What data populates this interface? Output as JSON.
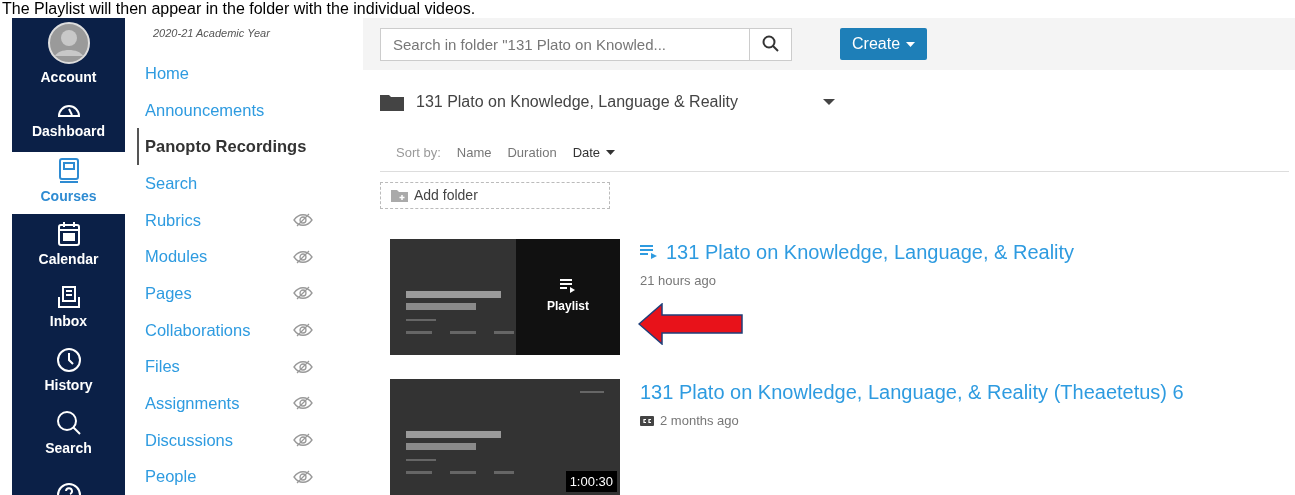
{
  "caption": "The Playlist will then appear in the folder with the individual videos.",
  "global_nav": [
    {
      "label": "Account",
      "kind": "avatar",
      "selected": false
    },
    {
      "label": "Dashboard",
      "kind": "gauge",
      "selected": false
    },
    {
      "label": "Courses",
      "kind": "book",
      "selected": true
    },
    {
      "label": "Calendar",
      "kind": "calendar",
      "selected": false
    },
    {
      "label": "Inbox",
      "kind": "inbox",
      "selected": false
    },
    {
      "label": "History",
      "kind": "clock",
      "selected": false
    },
    {
      "label": "Search",
      "kind": "search",
      "selected": false
    },
    {
      "kind": "help",
      "selected": false
    }
  ],
  "course_nav": {
    "term": "2020-21 Academic Year",
    "items": [
      {
        "label": "Home",
        "selected": false,
        "hidden": false
      },
      {
        "label": "Announcements",
        "selected": false,
        "hidden": false
      },
      {
        "label": "Panopto Recordings",
        "selected": true,
        "hidden": false
      },
      {
        "label": "Search",
        "selected": false,
        "hidden": false
      },
      {
        "label": "Rubrics",
        "selected": false,
        "hidden": true
      },
      {
        "label": "Modules",
        "selected": false,
        "hidden": true
      },
      {
        "label": "Pages",
        "selected": false,
        "hidden": true
      },
      {
        "label": "Collaborations",
        "selected": false,
        "hidden": true
      },
      {
        "label": "Files",
        "selected": false,
        "hidden": true
      },
      {
        "label": "Assignments",
        "selected": false,
        "hidden": true
      },
      {
        "label": "Discussions",
        "selected": false,
        "hidden": true
      },
      {
        "label": "People",
        "selected": false,
        "hidden": true
      }
    ]
  },
  "search": {
    "placeholder": "Search in folder \"131 Plato on Knowled..."
  },
  "create_button": "Create",
  "folder": {
    "name": "131 Plato on Knowledge, Language & Reality"
  },
  "sort": {
    "label": "Sort by:",
    "options": [
      {
        "label": "Name",
        "selected": false
      },
      {
        "label": "Duration",
        "selected": false
      },
      {
        "label": "Date",
        "selected": true
      }
    ]
  },
  "add_folder": "Add folder",
  "sessions": [
    {
      "kind": "playlist",
      "title": "131 Plato on Knowledge, Language, & Reality",
      "time": "21 hours ago",
      "overlay": "Playlist",
      "captions": false
    },
    {
      "kind": "video",
      "title": "131 Plato on Knowledge, Language, & Reality (Theaetetus) 6",
      "time": "2 months ago",
      "duration": "1:00:30",
      "captions": true
    }
  ]
}
